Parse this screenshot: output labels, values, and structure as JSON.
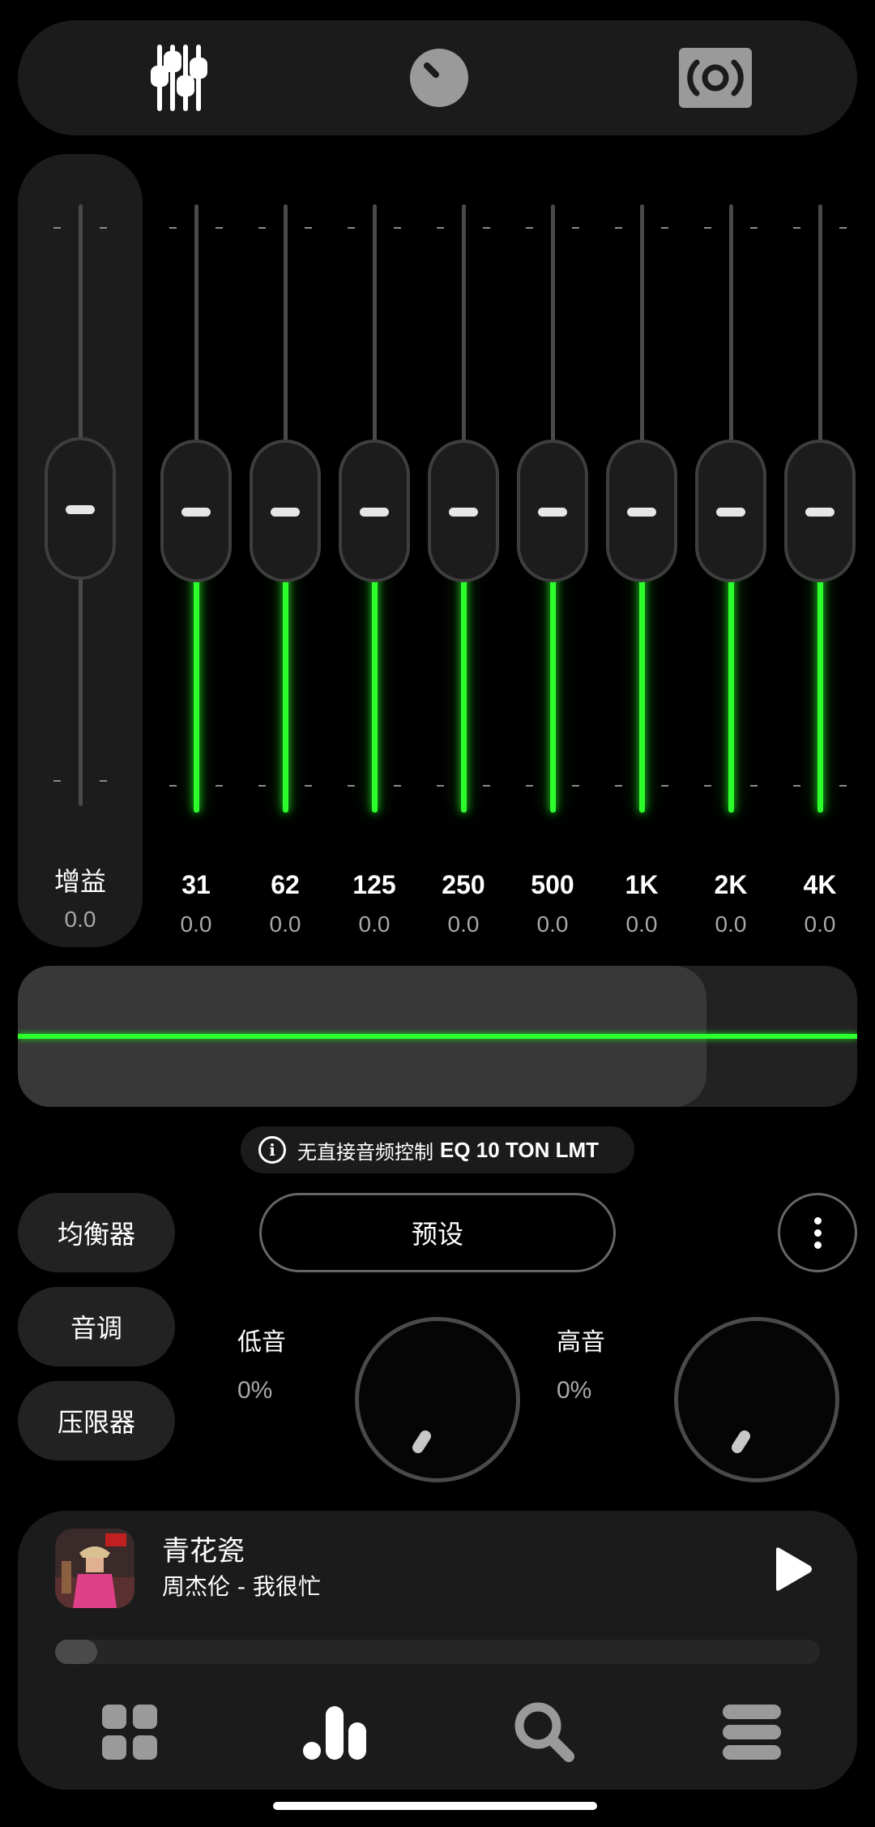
{
  "topbar": {
    "equalizer_icon": "equalizer-sliders-icon",
    "knob_icon": "knob-icon",
    "speaker_icon": "speaker-icon"
  },
  "gain": {
    "label": "增益",
    "value": "0.0",
    "level": 0.5
  },
  "bands": [
    {
      "freq": "31",
      "value": "0.0",
      "level": 0.5
    },
    {
      "freq": "62",
      "value": "0.0",
      "level": 0.5
    },
    {
      "freq": "125",
      "value": "0.0",
      "level": 0.5
    },
    {
      "freq": "250",
      "value": "0.0",
      "level": 0.5
    },
    {
      "freq": "500",
      "value": "0.0",
      "level": 0.5
    },
    {
      "freq": "1K",
      "value": "0.0",
      "level": 0.5
    },
    {
      "freq": "2K",
      "value": "0.0",
      "level": 0.5
    },
    {
      "freq": "4K",
      "value": "0.0",
      "level": 0.5
    }
  ],
  "visualizer": {
    "fill_fraction": 0.82,
    "line_color": "#2cff2c"
  },
  "info": {
    "text": "无直接音频控制",
    "code": "EQ 10 TON LMT"
  },
  "modes": {
    "equalizer": "均衡器",
    "tone": "音调",
    "limiter": "压限器"
  },
  "preset": {
    "label": "预设"
  },
  "tone": {
    "bass": {
      "label": "低音",
      "value": "0%"
    },
    "treble": {
      "label": "高音",
      "value": "0%"
    }
  },
  "player": {
    "title": "青花瓷",
    "subtitle": "周杰伦 - 我很忙",
    "progress": 0.0
  },
  "bottom_nav": [
    "grid-icon",
    "bars-chart-icon",
    "search-icon",
    "menu-icon"
  ],
  "colors": {
    "accent": "#2cff2c",
    "panel": "#1b1b1b",
    "background": "#000000"
  }
}
